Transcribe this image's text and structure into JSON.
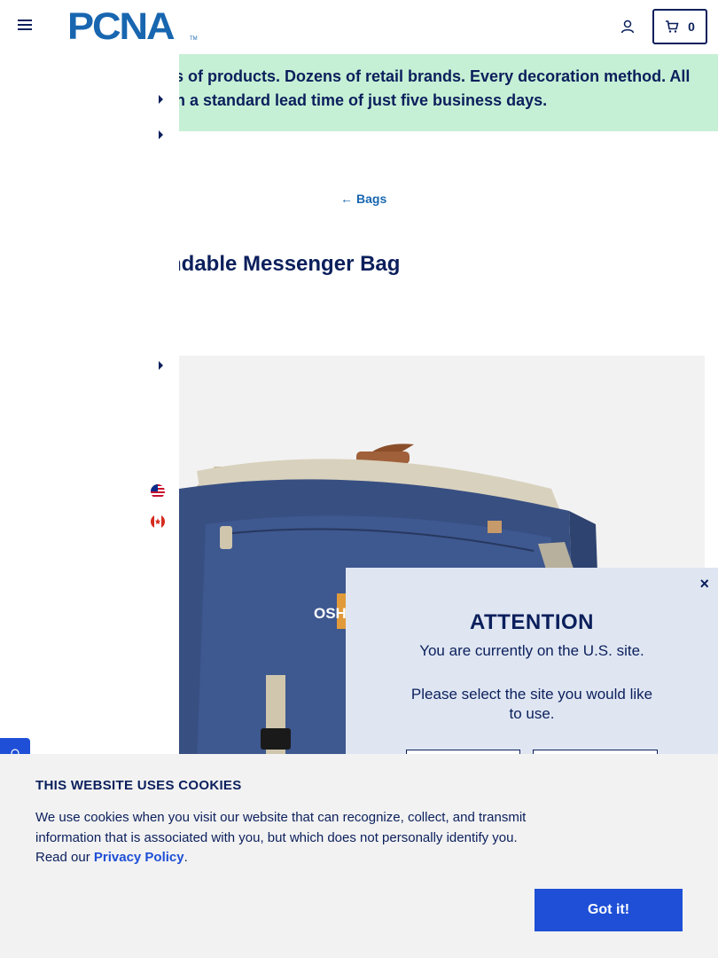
{
  "header": {
    "logo_text": "PCNA",
    "logo_tm": "TM",
    "cart_count": "0"
  },
  "banner": {
    "line1": "ls of products. Dozens of retail brands. Every decoration method. All",
    "line2": "th a standard lead time of just five business days."
  },
  "breadcrumb": {
    "back_label": "Bags"
  },
  "product": {
    "title": "ndable Messenger Bag",
    "bag_print": "OSH"
  },
  "attention": {
    "close": "×",
    "title": "ATTENTION",
    "line1": "You are currently on the U.S. site.",
    "line2": "Please select the site you would like to use."
  },
  "cookies": {
    "title": "THIS WEBSITE USES COOKIES",
    "text_before_link": "We use cookies when you visit our website that can recognize, collect, and transmit information that is associated with you, but which does not personally identify you. Read our ",
    "link_label": "Privacy Policy",
    "text_after_link": ".",
    "accept_label": "Got it!"
  },
  "colors": {
    "navy": "#0b1f5c",
    "brand_blue": "#1866b0",
    "button_blue": "#1e4fd6",
    "banner_green": "#c6f0d5",
    "modal_bg": "#dfe6f2"
  },
  "icons": {
    "menu": "hamburger-icon",
    "account": "user-icon",
    "cart": "cart-icon",
    "back": "arrow-left-icon",
    "chat": "chat-icon"
  }
}
